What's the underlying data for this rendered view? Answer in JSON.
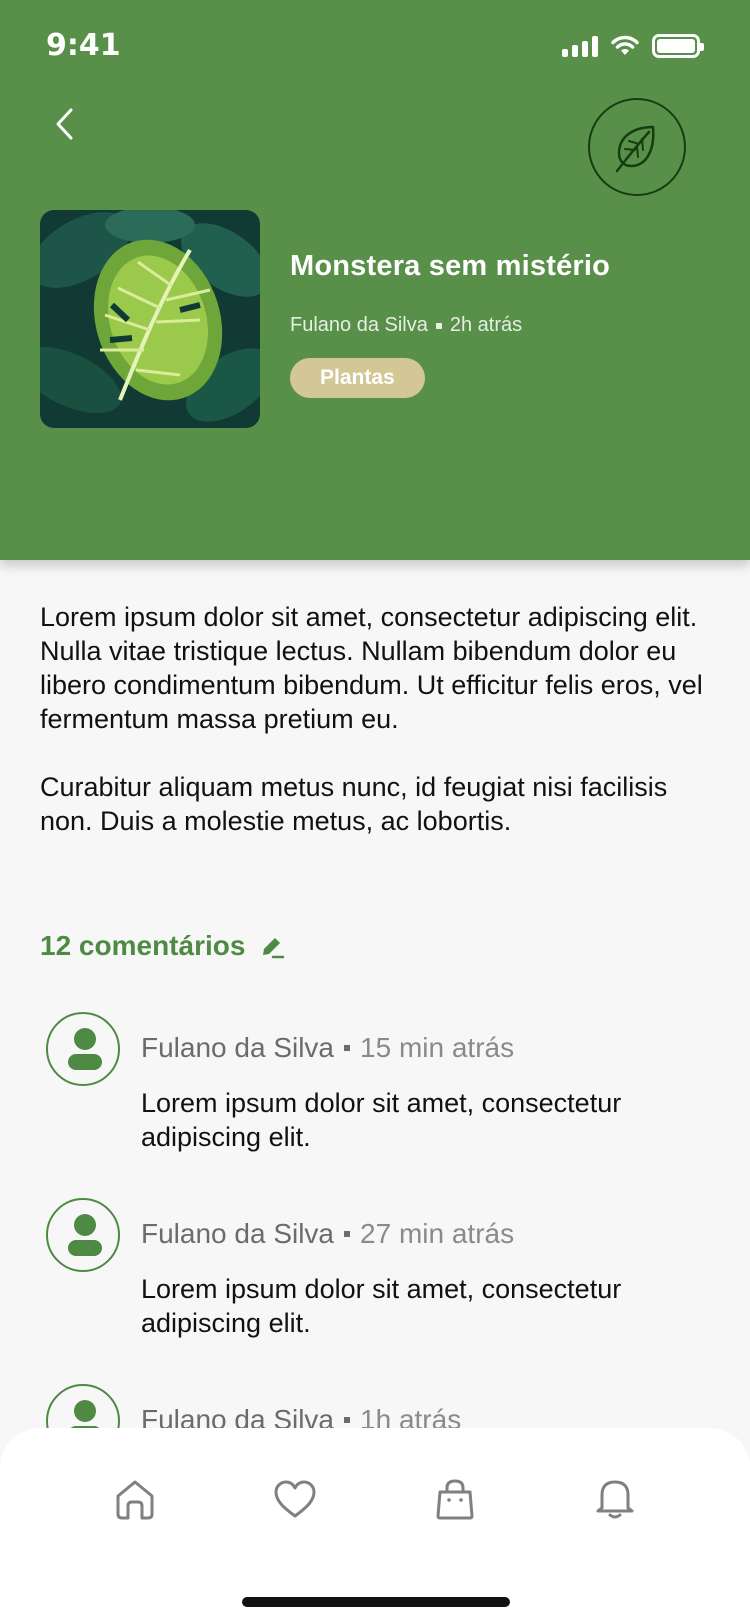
{
  "status_bar": {
    "time": "9:41"
  },
  "post": {
    "title": "Monstera sem mistério",
    "author": "Fulano da Silva",
    "posted_ago": "2h atrás",
    "tag": "Plantas",
    "paragraphs": [
      "Lorem ipsum dolor sit amet, consectetur adipiscing elit. Nulla vitae  tristique lectus. Nullam bibendum dolor eu libero condimentum bibendum.  Ut efficitur felis eros, vel fermentum massa pretium eu.",
      "Curabitur  aliquam metus nunc, id feugiat nisi facilisis non. Duis a molestie  metus, ac lobortis."
    ]
  },
  "comments_section": {
    "heading": "12 comentários",
    "items": [
      {
        "author": "Fulano da Silva",
        "time": "15 min atrás",
        "text": "Lorem ipsum dolor sit amet, consectetur adipiscing elit."
      },
      {
        "author": "Fulano da Silva",
        "time": "27 min atrás",
        "text": "Lorem ipsum dolor sit amet, consectetur adipiscing elit."
      },
      {
        "author": "Fulano da Silva",
        "time": "1h atrás",
        "text": ""
      }
    ]
  },
  "bottom_nav": {
    "items": [
      "home-icon",
      "heart-icon",
      "shopping-bag-icon",
      "bell-icon"
    ]
  },
  "colors": {
    "header_green": "#588f49",
    "accent_green": "#4f8a44",
    "tag_beige": "#d3c796"
  }
}
